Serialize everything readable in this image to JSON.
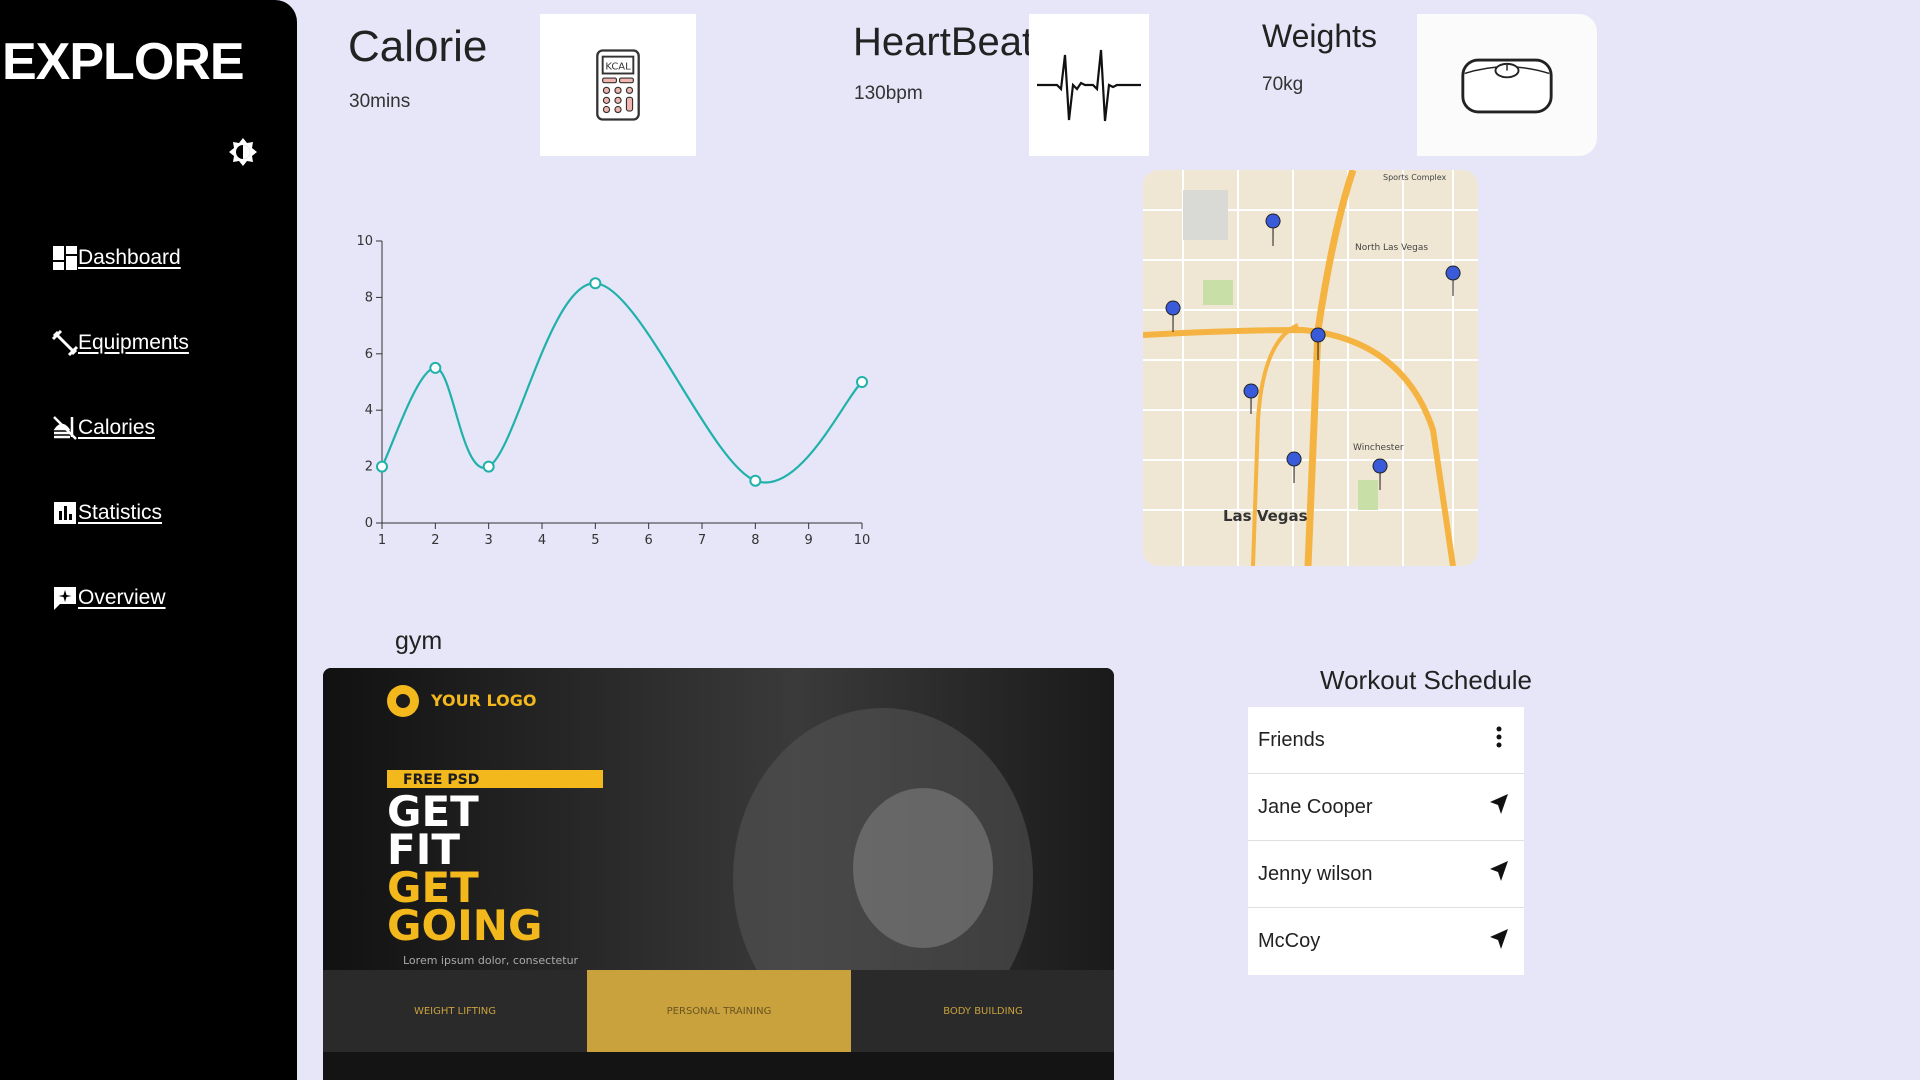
{
  "sidebar": {
    "brand": "EXPLORE",
    "toggle_icon": "brightness-icon",
    "items": [
      {
        "label": "Dashboard",
        "icon": "dashboard-icon"
      },
      {
        "label": "Equipments",
        "icon": "dumbbell-icon"
      },
      {
        "label": "Calories",
        "icon": "no-food-icon"
      },
      {
        "label": "Statistics",
        "icon": "bar-chart-icon"
      },
      {
        "label": "Overview",
        "icon": "overview-icon"
      }
    ]
  },
  "stats": {
    "calorie": {
      "title": "Calorie",
      "value": "30mins",
      "icon": "calculator-kcal-icon",
      "icon_text": "KCAL"
    },
    "heartbeat": {
      "title": "HeartBeat",
      "value": "130bpm",
      "icon": "heartbeat-icon"
    },
    "weights": {
      "title": "Weights",
      "value": "70kg",
      "icon": "scale-icon"
    }
  },
  "chart_data": {
    "type": "line",
    "x": [
      1,
      2,
      3,
      5,
      8,
      10
    ],
    "y": [
      2,
      5.5,
      2,
      8.5,
      1.5,
      5
    ],
    "x_ticks": [
      1,
      2,
      3,
      4,
      5,
      6,
      7,
      8,
      9,
      10
    ],
    "y_ticks": [
      0,
      2,
      4,
      6,
      8,
      10
    ],
    "xlim": [
      1,
      10
    ],
    "ylim": [
      0,
      10
    ],
    "color": "#20b2aa",
    "smooth": true
  },
  "map": {
    "city_label": "Las Vegas",
    "labels": [
      "North Las Vegas",
      "Winchester",
      "Sports Complex"
    ]
  },
  "gym": {
    "label": "gym",
    "poster": {
      "logo": "YOUR LOGO",
      "badge": "FREE PSD",
      "line1": "GET",
      "line2": "FIT",
      "line3": "GET",
      "line4": "GOING",
      "sub": "Lorem ipsum dolor, consectetur",
      "panels": [
        "WEIGHT LIFTING",
        "PERSONAL TRAINING",
        "BODY BUILDING"
      ]
    }
  },
  "workout": {
    "title": "Workout Schedule",
    "rows": [
      {
        "name": "Friends",
        "icon": "more-vertical-icon"
      },
      {
        "name": "Jane Cooper",
        "icon": "navigation-icon"
      },
      {
        "name": "Jenny wilson",
        "icon": "navigation-icon"
      },
      {
        "name": "McCoy",
        "icon": "navigation-icon"
      }
    ]
  },
  "colors": {
    "background": "#e6e6f8",
    "sidebar": "#000000",
    "accent": "#20b2aa",
    "poster_gold": "#f2b81c"
  }
}
